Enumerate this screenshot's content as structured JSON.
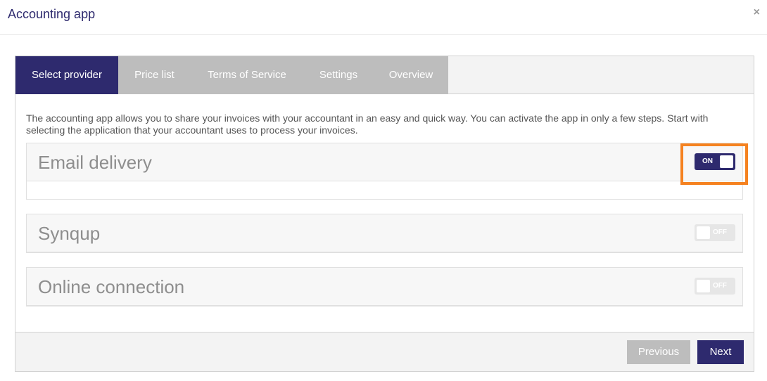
{
  "header": {
    "title": "Accounting app",
    "close_label": "×"
  },
  "tabs": [
    {
      "label": "Select provider",
      "active": true
    },
    {
      "label": "Price list",
      "active": false
    },
    {
      "label": "Terms of Service",
      "active": false
    },
    {
      "label": "Settings",
      "active": false
    },
    {
      "label": "Overview",
      "active": false
    }
  ],
  "intro_text": "The accounting app allows you to share your invoices with your accountant in an easy and quick way. You can activate the app in only a few steps. Start with selecting the application that your accountant uses to process your invoices.",
  "providers": [
    {
      "name": "Email delivery",
      "toggle_label": "ON",
      "enabled": true
    },
    {
      "name": "Synqup",
      "toggle_label": "OFF",
      "enabled": false
    },
    {
      "name": "Online connection",
      "toggle_label": "OFF",
      "enabled": false
    }
  ],
  "footer": {
    "previous_label": "Previous",
    "next_label": "Next"
  },
  "colors": {
    "brand": "#2e2a6e",
    "inactive": "#bdbdbd",
    "highlight": "#f58220"
  }
}
